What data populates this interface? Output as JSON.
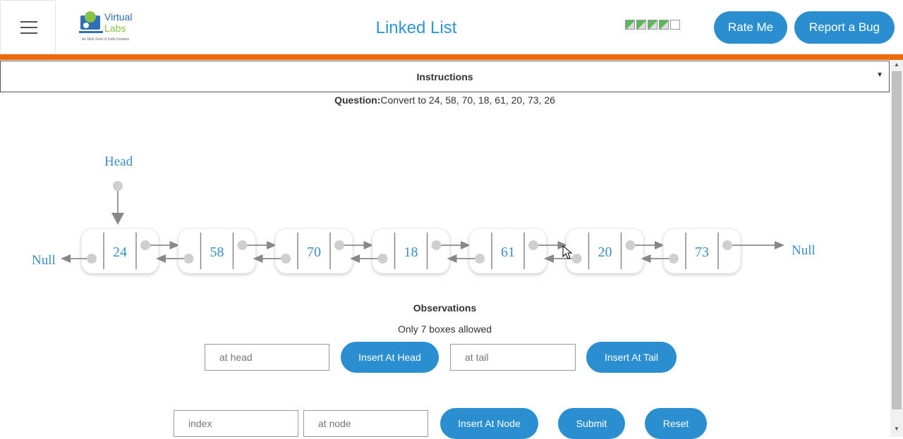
{
  "header": {
    "title": "Linked List",
    "logo_line1": "Virtual",
    "logo_line2": "Labs",
    "logo_tagline": "An MoE Govt of India Initiative",
    "rate_label": "Rate Me",
    "report_label": "Report a Bug"
  },
  "instructions": {
    "label": "Instructions"
  },
  "question": {
    "prefix": "Question:",
    "text": "Convert to 24, 58, 70, 18, 61, 20, 73, 26"
  },
  "diagram": {
    "head_label": "Head",
    "left_null": "Null",
    "right_null": "Null",
    "nodes": [
      "24",
      "58",
      "70",
      "18",
      "61",
      "20",
      "73"
    ]
  },
  "observations": {
    "title": "Observations",
    "text": "Only 7 boxes allowed"
  },
  "controls": {
    "at_head_placeholder": "at head",
    "insert_head_label": "Insert At Head",
    "at_tail_placeholder": "at tail",
    "insert_tail_label": "Insert At Tail",
    "index_placeholder": "index",
    "at_node_placeholder": "at node",
    "insert_node_label": "Insert At Node",
    "submit_label": "Submit",
    "reset_label": "Reset"
  },
  "colors": {
    "accent": "#2b8fcf",
    "orange_bar": "#ea6a0d",
    "title": "#2f96d3",
    "node_text": "#3a8fc4"
  }
}
